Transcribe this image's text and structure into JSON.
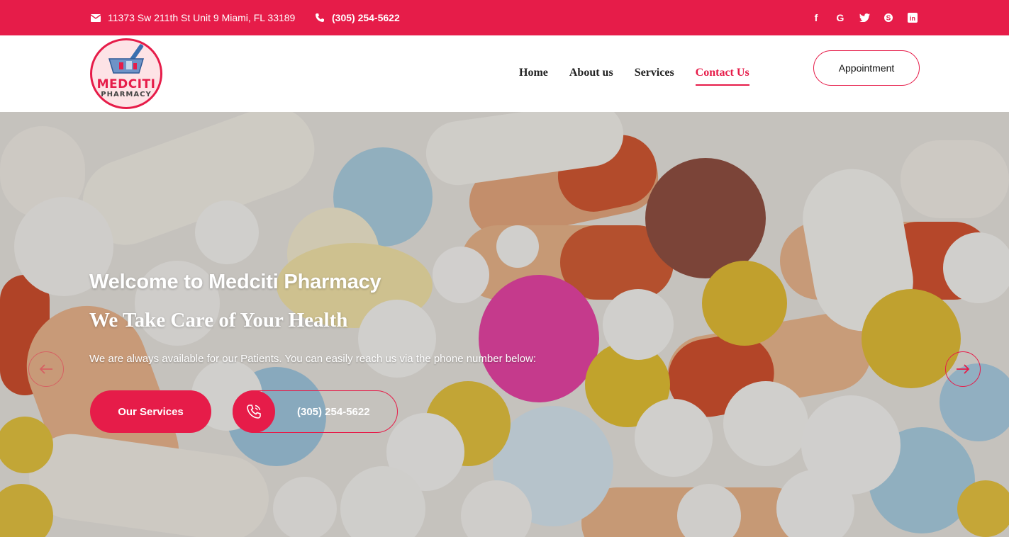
{
  "topbar": {
    "address": "11373 Sw 211th St Unit 9 Miami, FL 33189",
    "phone": "(305) 254-5622",
    "socials": [
      {
        "icon": "facebook-icon",
        "glyph": "f"
      },
      {
        "icon": "google-icon",
        "glyph": "G"
      },
      {
        "icon": "twitter-icon",
        "glyph": "t"
      },
      {
        "icon": "skype-icon",
        "glyph": "S"
      },
      {
        "icon": "linkedin-icon",
        "glyph": "in"
      }
    ]
  },
  "logo": {
    "line1": "MEDCITI",
    "line2": "PHARMACY"
  },
  "nav": {
    "items": [
      {
        "label": "Home",
        "active": false
      },
      {
        "label": "About us",
        "active": false
      },
      {
        "label": "Services",
        "active": false
      },
      {
        "label": "Contact Us",
        "active": true
      }
    ],
    "appointment": "Appointment"
  },
  "hero": {
    "title": "Welcome to Medciti Pharmacy",
    "subtitle": "We Take Care of Your Health",
    "text": "We are always available for our Patients. You can easily reach us via the phone number below:",
    "services_button": "Our Services",
    "phone_button": "(305) 254-5622"
  },
  "colors": {
    "accent": "#e61c49"
  }
}
